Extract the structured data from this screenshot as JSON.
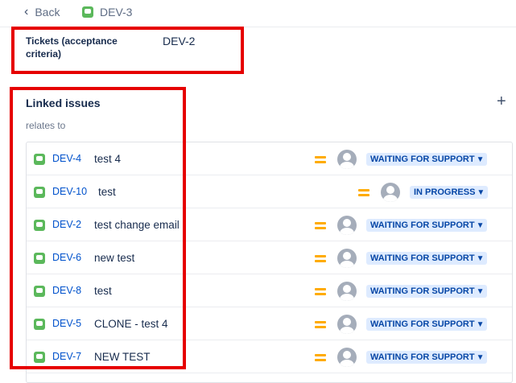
{
  "header": {
    "back_label": "Back",
    "back_icon": "chevron-left-icon",
    "issue_key": "DEV-3",
    "issue_type_icon": "story-icon"
  },
  "field": {
    "label": "Tickets (acceptance criteria)",
    "value": "DEV-2"
  },
  "linked_issues": {
    "title": "Linked issues",
    "add_icon": "plus-icon",
    "relation": "relates to",
    "items": [
      {
        "key": "DEV-4",
        "summary": "test 4",
        "status": "WAITING FOR SUPPORT",
        "priority": "medium-priority-icon"
      },
      {
        "key": "DEV-10",
        "summary": "test",
        "status": "IN PROGRESS",
        "priority": "medium-priority-icon"
      },
      {
        "key": "DEV-2",
        "summary": "test change email",
        "status": "WAITING FOR SUPPORT",
        "priority": "medium-priority-icon"
      },
      {
        "key": "DEV-6",
        "summary": "new test",
        "status": "WAITING FOR SUPPORT",
        "priority": "medium-priority-icon"
      },
      {
        "key": "DEV-8",
        "summary": "test",
        "status": "WAITING FOR SUPPORT",
        "priority": "medium-priority-icon"
      },
      {
        "key": "DEV-5",
        "summary": "CLONE - test 4",
        "status": "WAITING FOR SUPPORT",
        "priority": "medium-priority-icon"
      },
      {
        "key": "DEV-7",
        "summary": "NEW TEST",
        "status": "WAITING FOR SUPPORT",
        "priority": "medium-priority-icon"
      }
    ]
  },
  "colors": {
    "highlight_box": "#e60000",
    "link": "#0052cc",
    "status_bg": "#deebff",
    "status_text": "#0747a6",
    "priority": "#ffab00",
    "issue_type": "#5bb85b"
  }
}
